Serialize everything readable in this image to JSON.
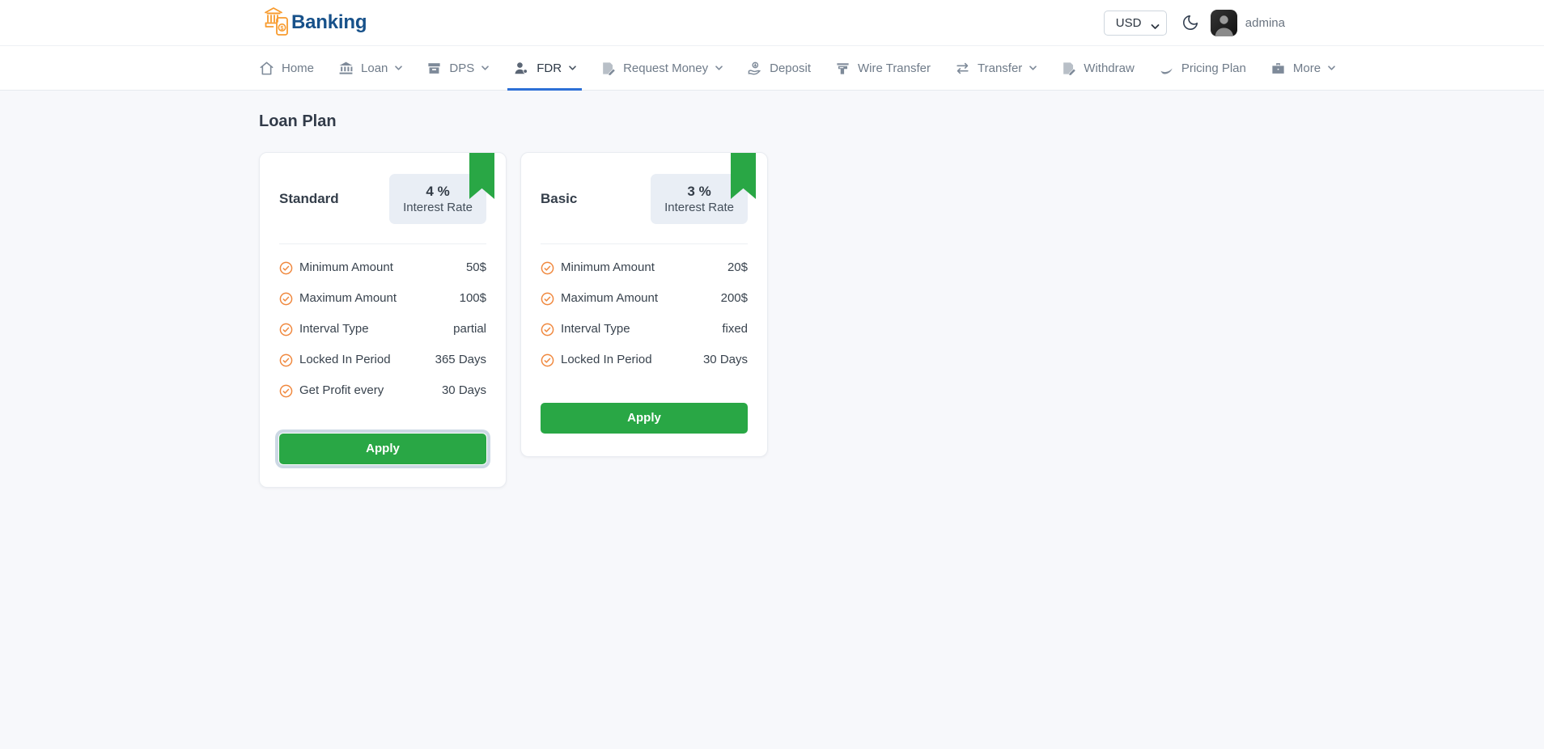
{
  "brand": {
    "name": "Banking"
  },
  "header": {
    "currency_selected": "USD",
    "username": "admina"
  },
  "nav": {
    "items": [
      {
        "label": "Home",
        "dropdown": false,
        "active": false
      },
      {
        "label": "Loan",
        "dropdown": true,
        "active": false
      },
      {
        "label": "DPS",
        "dropdown": true,
        "active": false
      },
      {
        "label": "FDR",
        "dropdown": true,
        "active": true
      },
      {
        "label": "Request Money",
        "dropdown": true,
        "active": false
      },
      {
        "label": "Deposit",
        "dropdown": false,
        "active": false
      },
      {
        "label": "Wire Transfer",
        "dropdown": false,
        "active": false
      },
      {
        "label": "Transfer",
        "dropdown": true,
        "active": false
      },
      {
        "label": "Withdraw",
        "dropdown": false,
        "active": false
      },
      {
        "label": "Pricing Plan",
        "dropdown": false,
        "active": false
      },
      {
        "label": "More",
        "dropdown": true,
        "active": false
      }
    ]
  },
  "page": {
    "title": "Loan Plan"
  },
  "plans": [
    {
      "name": "Standard",
      "interest_value": "4 %",
      "interest_label": "Interest Rate",
      "features": [
        {
          "label": "Minimum Amount",
          "value": "50$"
        },
        {
          "label": "Maximum Amount",
          "value": "100$"
        },
        {
          "label": "Interval Type",
          "value": "partial"
        },
        {
          "label": "Locked In Period",
          "value": "365 Days"
        },
        {
          "label": "Get Profit every",
          "value": "30 Days"
        }
      ],
      "apply_label": "Apply"
    },
    {
      "name": "Basic",
      "interest_value": "3 %",
      "interest_label": "Interest Rate",
      "features": [
        {
          "label": "Minimum Amount",
          "value": "20$"
        },
        {
          "label": "Maximum Amount",
          "value": "200$"
        },
        {
          "label": "Interval Type",
          "value": "fixed"
        },
        {
          "label": "Locked In Period",
          "value": "30 Days"
        }
      ],
      "apply_label": "Apply"
    }
  ],
  "colors": {
    "brand_blue": "#17518a",
    "brand_orange": "#f89b2e",
    "accent_green": "#29a745",
    "check_orange": "#f0883e",
    "active_tab_blue": "#2d6fd6"
  }
}
